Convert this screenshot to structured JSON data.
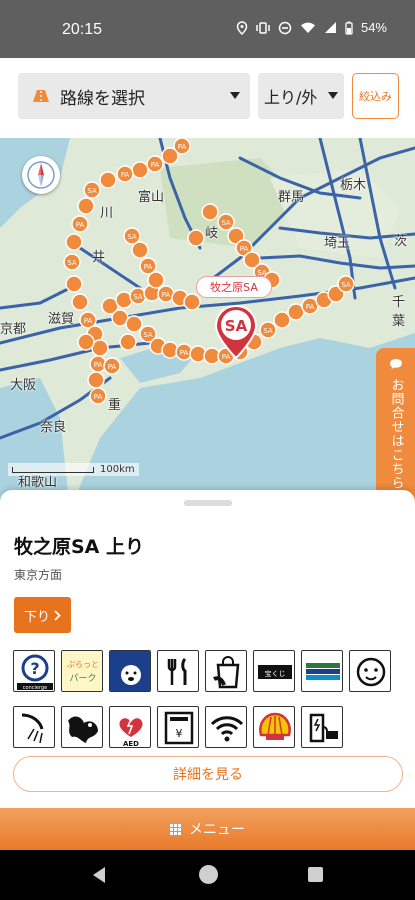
{
  "status": {
    "time": "20:15",
    "battery": "54%"
  },
  "topbar": {
    "route_label": "路線を選択",
    "direction_label": "上り/外",
    "filter_label": "絞込み"
  },
  "map": {
    "places": [
      "富山",
      "群馬",
      "栃木",
      "埼玉",
      "茨",
      "千葉",
      "滋賀",
      "京都",
      "大阪",
      "奈良",
      "和歌山",
      "川",
      "井",
      "岐",
      "重"
    ],
    "scale_label": "100km",
    "marker_label": "SA",
    "small_marker_labels": [
      "SA",
      "PA"
    ],
    "callout": "牧之原SA"
  },
  "contact_tab": {
    "label": "お問合せはこちら"
  },
  "sheet": {
    "title": "牧之原SA 上り",
    "subtitle": "東京方面",
    "down_button": "下り",
    "detail_button": "詳細を見る",
    "facilities": [
      {
        "icon": "concierge-icon",
        "label": "concierge"
      },
      {
        "icon": "drop-in-park-icon",
        "label": "ぷらっと パーク"
      },
      {
        "icon": "dog-run-icon",
        "label": ""
      },
      {
        "icon": "restaurant-icon",
        "label": ""
      },
      {
        "icon": "shopping-icon",
        "label": ""
      },
      {
        "icon": "lottery-icon",
        "label": "宝くじ"
      },
      {
        "icon": "highway-info-icon",
        "label": ""
      },
      {
        "icon": "baby-corner-icon",
        "label": ""
      },
      {
        "icon": "shower-icon",
        "label": ""
      },
      {
        "icon": "dog-icon",
        "label": ""
      },
      {
        "icon": "aed-icon",
        "label": "AED"
      },
      {
        "icon": "atm-icon",
        "label": "¥"
      },
      {
        "icon": "wifi-icon",
        "label": ""
      },
      {
        "icon": "shell-gas-icon",
        "label": ""
      },
      {
        "icon": "ev-charger-icon",
        "label": ""
      }
    ]
  },
  "menu": {
    "label": "メニュー"
  },
  "colors": {
    "accent": "#e8731e",
    "marker": "#f08a3c",
    "sa_red": "#d1343e"
  }
}
